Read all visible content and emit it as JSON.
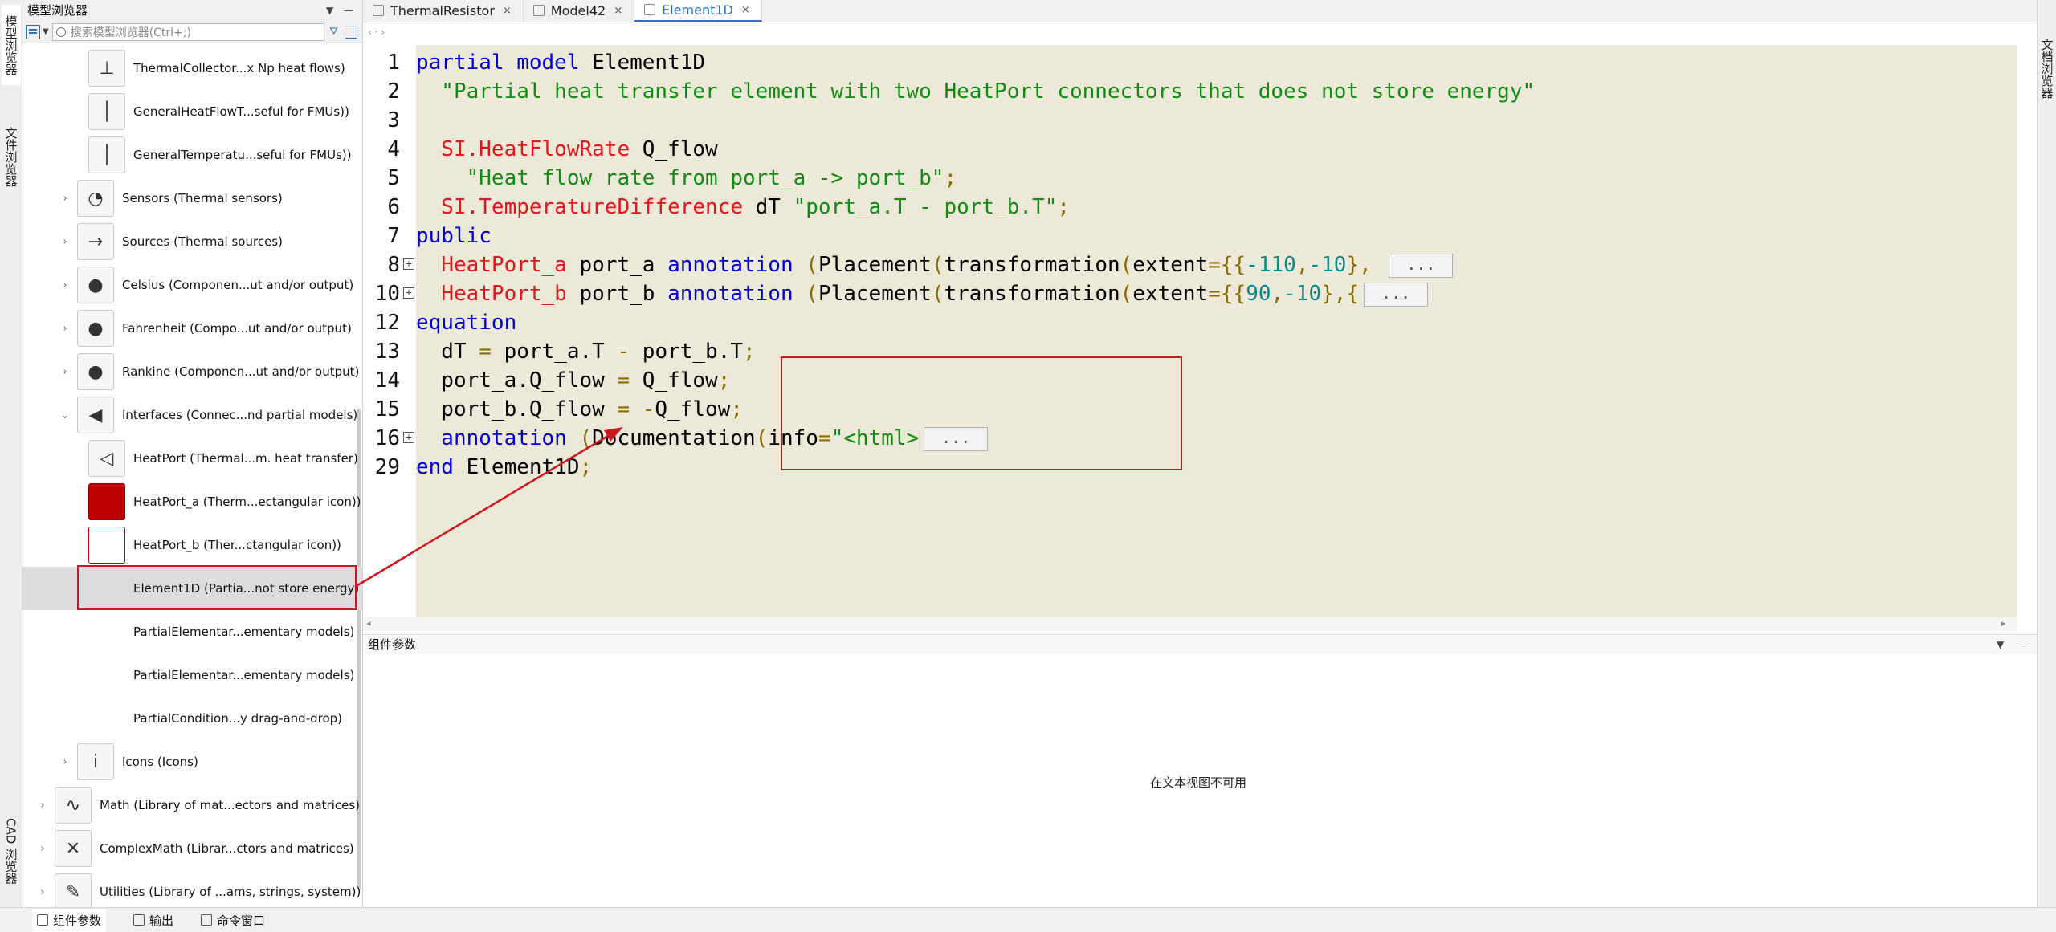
{
  "left_strip": {
    "tabs": [
      "模型浏览器",
      "文件浏览器",
      "CAD 浏览器"
    ]
  },
  "right_strip": {
    "tabs": [
      "文档浏览器"
    ]
  },
  "browser": {
    "title": "模型浏览器",
    "search_placeholder": "搜索模型浏览器(Ctrl+;)",
    "items": [
      {
        "label": "ThermalCollector...x Np heat flows)",
        "level": 2,
        "expander": ""
      },
      {
        "label": "GeneralHeatFlowT...seful for FMUs))",
        "level": 2,
        "expander": ""
      },
      {
        "label": "GeneralTemperatu...seful for FMUs))",
        "level": 2,
        "expander": ""
      },
      {
        "label": "Sensors (Thermal sensors)",
        "level": 1,
        "expander": "›"
      },
      {
        "label": "Sources (Thermal sources)",
        "level": 1,
        "expander": "›"
      },
      {
        "label": "Celsius (Componen...ut and/or output)",
        "level": 1,
        "expander": "›"
      },
      {
        "label": "Fahrenheit (Compo...ut and/or output)",
        "level": 1,
        "expander": "›"
      },
      {
        "label": "Rankine (Componen...ut and/or output)",
        "level": 1,
        "expander": "›"
      },
      {
        "label": "Interfaces (Connec...nd partial models)",
        "level": 1,
        "expander": "⌄"
      },
      {
        "label": "HeatPort (Thermal...m. heat transfer)",
        "level": 2,
        "expander": ""
      },
      {
        "label": "HeatPort_a (Therm...ectangular icon))",
        "level": 2,
        "expander": ""
      },
      {
        "label": "HeatPort_b (Ther...ctangular icon))",
        "level": 2,
        "expander": ""
      },
      {
        "label": "Element1D (Partia...not store energy)",
        "level": 2,
        "expander": ""
      },
      {
        "label": "PartialElementar...ementary models)",
        "level": 2,
        "expander": ""
      },
      {
        "label": "PartialElementar...ementary models)",
        "level": 2,
        "expander": ""
      },
      {
        "label": "PartialCondition...y drag-and-drop)",
        "level": 2,
        "expander": ""
      },
      {
        "label": "Icons (Icons)",
        "level": 1,
        "expander": "›"
      },
      {
        "label": "Math (Library of mat...ectors and matrices)",
        "level": 0,
        "expander": "›"
      },
      {
        "label": "ComplexMath (Librar...ctors and matrices)",
        "level": 0,
        "expander": "›"
      },
      {
        "label": "Utilities (Library of ...ams, strings, system))",
        "level": 0,
        "expander": "›"
      }
    ]
  },
  "editor": {
    "tabs": [
      {
        "label": "ThermalResistor",
        "active": false
      },
      {
        "label": "Model42",
        "active": false
      },
      {
        "label": "Element1D",
        "active": true
      }
    ],
    "breadcrumb": "‹ · ›",
    "lines": [
      {
        "no": "1",
        "fold": "",
        "segments": [
          [
            "kw",
            "partial model "
          ],
          [
            "",
            "Element1D"
          ]
        ]
      },
      {
        "no": "2",
        "fold": "",
        "segments": [
          [
            "st",
            "  \"Partial heat transfer element with two HeatPort connectors that does not store energy\""
          ]
        ]
      },
      {
        "no": "3",
        "fold": "",
        "segments": []
      },
      {
        "no": "4",
        "fold": "",
        "segments": [
          [
            "ty",
            "  SI.HeatFlowRate"
          ],
          [
            "",
            " Q_flow"
          ]
        ]
      },
      {
        "no": "5",
        "fold": "",
        "segments": [
          [
            "st",
            "    \"Heat flow rate from port_a -> port_b\""
          ],
          [
            "pu",
            ";"
          ]
        ]
      },
      {
        "no": "6",
        "fold": "",
        "segments": [
          [
            "ty",
            "  SI.TemperatureDifference"
          ],
          [
            "",
            " dT "
          ],
          [
            "st",
            "\"port_a.T - port_b.T\""
          ],
          [
            "pu",
            ";"
          ]
        ]
      },
      {
        "no": "7",
        "fold": "",
        "segments": [
          [
            "kw",
            "public"
          ]
        ]
      },
      {
        "no": "8",
        "fold": "⊞",
        "segments": [
          [
            "ty",
            "  HeatPort_a"
          ],
          [
            "",
            " port_a "
          ],
          [
            "kw",
            "annotation"
          ],
          [
            "",
            " "
          ],
          [
            "pu",
            "("
          ],
          [
            "",
            "Placement"
          ],
          [
            "pu",
            "("
          ],
          [
            "",
            "transformation"
          ],
          [
            "pu",
            "("
          ],
          [
            "",
            "extent"
          ],
          [
            "pu",
            "={{"
          ],
          [
            "nm",
            "-110"
          ],
          [
            "pu",
            ","
          ],
          [
            "nm",
            "-10"
          ],
          [
            "pu",
            "}, "
          ]
        ],
        "ellipsis": "..."
      },
      {
        "no": "10",
        "fold": "⊞",
        "segments": [
          [
            "ty",
            "  HeatPort_b"
          ],
          [
            "",
            " port_b "
          ],
          [
            "kw",
            "annotation"
          ],
          [
            "",
            " "
          ],
          [
            "pu",
            "("
          ],
          [
            "",
            "Placement"
          ],
          [
            "pu",
            "("
          ],
          [
            "",
            "transformation"
          ],
          [
            "pu",
            "("
          ],
          [
            "",
            "extent"
          ],
          [
            "pu",
            "={{"
          ],
          [
            "nm",
            "90"
          ],
          [
            "pu",
            ","
          ],
          [
            "nm",
            "-10"
          ],
          [
            "pu",
            "},{"
          ]
        ],
        "ellipsis": "..."
      },
      {
        "no": "12",
        "fold": "",
        "segments": [
          [
            "kw",
            "equation"
          ]
        ]
      },
      {
        "no": "13",
        "fold": "",
        "segments": [
          [
            "",
            "  dT "
          ],
          [
            "pu",
            "="
          ],
          [
            "",
            " port_a.T "
          ],
          [
            "pu",
            "-"
          ],
          [
            "",
            " port_b.T"
          ],
          [
            "pu",
            ";"
          ]
        ]
      },
      {
        "no": "14",
        "fold": "",
        "segments": [
          [
            "",
            "  port_a.Q_flow "
          ],
          [
            "pu",
            "="
          ],
          [
            "",
            " Q_flow"
          ],
          [
            "pu",
            ";"
          ]
        ]
      },
      {
        "no": "15",
        "fold": "",
        "segments": [
          [
            "",
            "  port_b.Q_flow "
          ],
          [
            "pu",
            "="
          ],
          [
            "",
            " "
          ],
          [
            "pu",
            "-"
          ],
          [
            "",
            "Q_flow"
          ],
          [
            "pu",
            ";"
          ]
        ]
      },
      {
        "no": "16",
        "fold": "⊞",
        "segments": [
          [
            "kw",
            "  annotation"
          ],
          [
            "",
            " "
          ],
          [
            "pu",
            "("
          ],
          [
            "",
            "Documentation"
          ],
          [
            "pu",
            "("
          ],
          [
            "",
            "info"
          ],
          [
            "pu",
            "="
          ],
          [
            "st",
            "\"<html>"
          ]
        ],
        "ellipsis": "..."
      },
      {
        "no": "29",
        "fold": "",
        "segments": [
          [
            "kw",
            "end"
          ],
          [
            "",
            " Element1D"
          ],
          [
            "pu",
            ";"
          ]
        ]
      }
    ]
  },
  "params": {
    "title": "组件参数",
    "message": "在文本视图不可用"
  },
  "bottom_tabs": [
    {
      "label": "组件参数",
      "active": true
    },
    {
      "label": "输出",
      "active": false
    },
    {
      "label": "命令窗口",
      "active": false
    }
  ],
  "colors": {
    "keyword": "#0000d0",
    "type": "#e2151b",
    "string": "#138a13",
    "number": "#0a8a8a",
    "highlight_box": "#d0161d",
    "code_background": "#ece9d8"
  }
}
